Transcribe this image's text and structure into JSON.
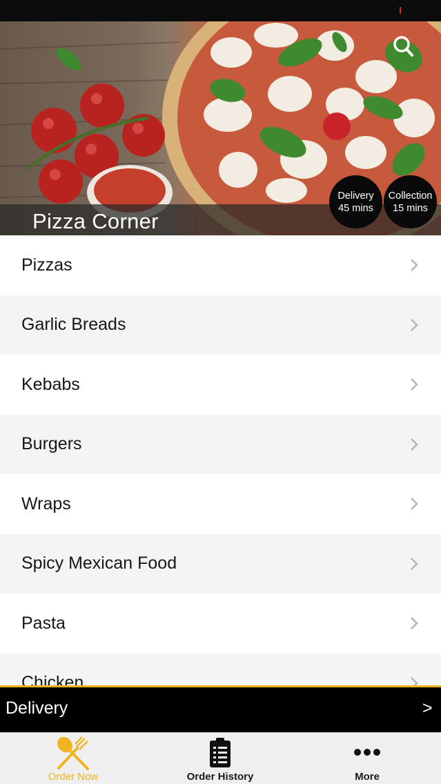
{
  "restaurant": {
    "name": "Pizza Corner"
  },
  "badges": {
    "delivery": {
      "label": "Delivery",
      "time": "45 mins"
    },
    "collection": {
      "label": "Collection",
      "time": "15 mins"
    }
  },
  "menu": {
    "categories": [
      "Pizzas",
      "Garlic Breads",
      "Kebabs",
      "Burgers",
      "Wraps",
      "Spicy Mexican Food",
      "Pasta",
      "Chicken"
    ]
  },
  "order_bar": {
    "mode": "Delivery",
    "arrow": ">"
  },
  "tabs": {
    "order_now": "Order Now",
    "order_history": "Order History",
    "more": "More"
  },
  "icons": {
    "search": "search-icon",
    "chevron": "chevron-right-icon",
    "order_now": "fork-spoon-icon",
    "order_history": "clipboard-list-icon",
    "more": "ellipsis-icon"
  },
  "colors": {
    "accent": "#f0b41e",
    "top_bar": "#0c0c0c",
    "badge_bg": "#0a0a0a",
    "row_alt": "#f4f4f6"
  }
}
